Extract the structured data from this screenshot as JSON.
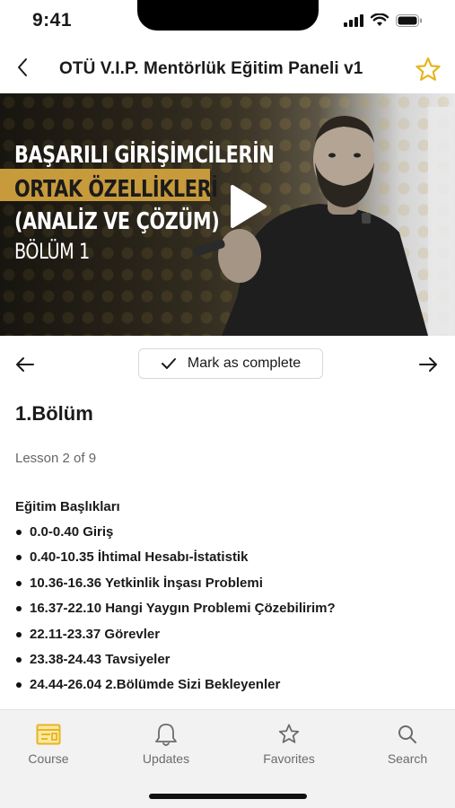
{
  "status_bar": {
    "time": "9:41"
  },
  "header": {
    "title": "OTÜ V.I.P. Mentörlük Eğitim Paneli v1"
  },
  "video": {
    "overlay_line1": "BAŞARILI GİRİŞİMCİLERİN",
    "overlay_line2": "ORTAK ÖZELLİKLERİ",
    "overlay_line3": "(ANALİZ VE ÇÖZÜM)",
    "overlay_line4": "BÖLÜM 1",
    "accent_color": "#c79a3b"
  },
  "lesson_nav": {
    "mark_complete_label": "Mark as complete"
  },
  "lesson": {
    "title": "1.Bölüm",
    "progress": "Lesson 2 of 9",
    "topics_heading": "Eğitim Başlıkları",
    "topics": [
      "0.0-0.40 Giriş",
      "0.40-10.35 İhtimal Hesabı-İstatistik",
      "10.36-16.36 Yetkinlik İnşası Problemi",
      "16.37-22.10 Hangi Yaygın Problemi Çözebilirim?",
      "22.11-23.37 Görevler",
      "23.38-24.43 Tavsiyeler",
      "24.44-26.04 2.Bölümde Sizi Bekleyenler"
    ]
  },
  "tab_bar": {
    "course_label": "Course",
    "updates_label": "Updates",
    "favorites_label": "Favorites",
    "search_label": "Search",
    "active_color": "#e6b520"
  }
}
